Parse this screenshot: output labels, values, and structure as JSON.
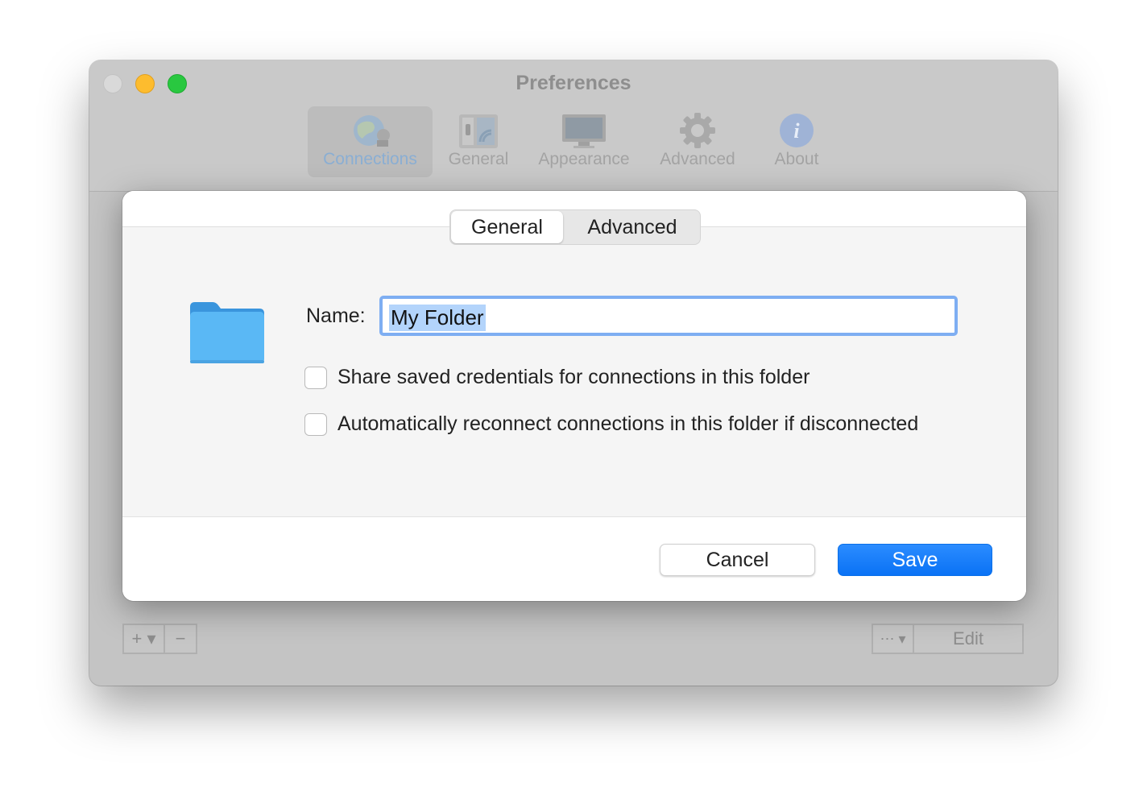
{
  "window": {
    "title": "Preferences",
    "toolbar": [
      {
        "label": "Connections",
        "icon": "globe-network-icon",
        "selected": true
      },
      {
        "label": "General",
        "icon": "switch-panel-icon",
        "selected": false
      },
      {
        "label": "Appearance",
        "icon": "monitor-icon",
        "selected": false
      },
      {
        "label": "Advanced",
        "icon": "gear-icon",
        "selected": false
      },
      {
        "label": "About",
        "icon": "info-icon",
        "selected": false
      }
    ],
    "bottom_bar": {
      "add_label": "+ ▾",
      "remove_label": "−",
      "action_label": "⋯ ▾",
      "edit_label": "Edit"
    }
  },
  "sheet": {
    "tabs": {
      "general": "General",
      "advanced": "Advanced",
      "selected": "General"
    },
    "name_label": "Name:",
    "name_value": "My Folder",
    "checkboxes": [
      {
        "label": "Share saved credentials for connections in this folder",
        "checked": false
      },
      {
        "label": "Automatically reconnect connections in this folder if disconnected",
        "checked": false
      }
    ],
    "cancel_label": "Cancel",
    "save_label": "Save"
  },
  "colors": {
    "accent": "#0a72f5",
    "focus_ring": "#7eaef2",
    "folder": "#5ab8f5"
  }
}
